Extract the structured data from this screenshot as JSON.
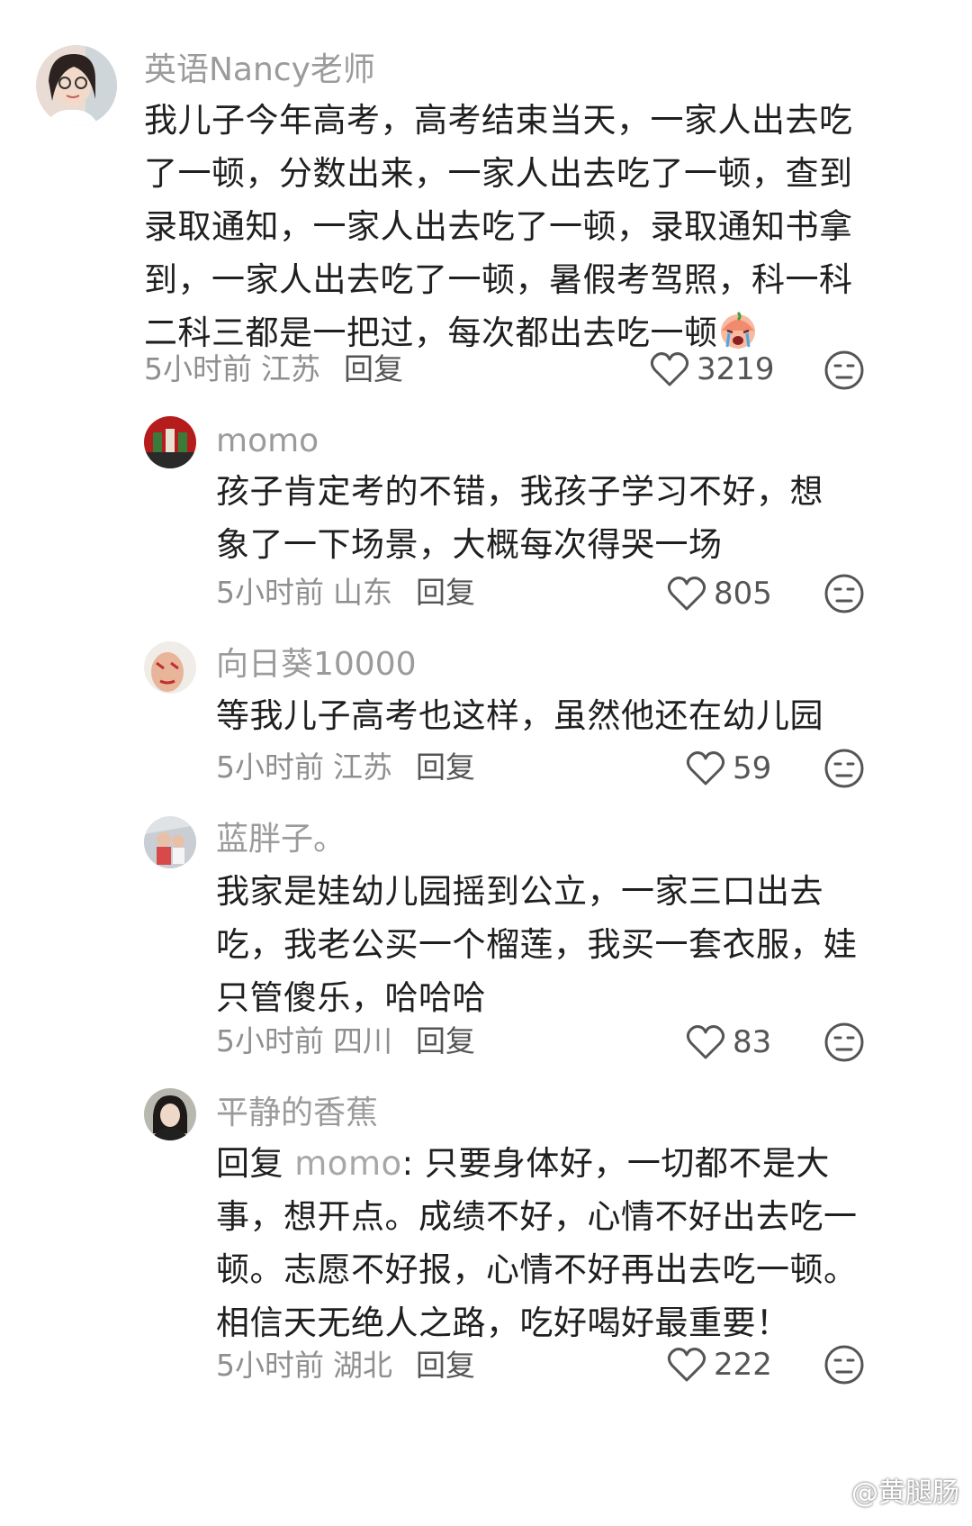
{
  "comments": [
    {
      "user": "英语Nancy老师",
      "text": "我儿子今年高考，高考结束当天，一家人出去吃了一顿，分数出来，一家人出去吃了一顿，查到录取通知，一家人出去吃了一顿，录取通知书拿到，一家人出去吃了一顿，暑假考驾照，科一科二科三都是一把过，每次都出去吃一顿",
      "emoji": "crying-face-emoji",
      "time": "5小时前",
      "location": "江苏",
      "reply_label": "回复",
      "likes": "3219"
    },
    {
      "user": "momo",
      "text": "孩子肯定考的不错，我孩子学习不好，想象了一下场景，大概每次得哭一场",
      "time": "5小时前",
      "location": "山东",
      "reply_label": "回复",
      "likes": "805"
    },
    {
      "user": "向日葵10000",
      "text": "等我儿子高考也这样，虽然他还在幼儿园",
      "time": "5小时前",
      "location": "江苏",
      "reply_label": "回复",
      "likes": "59"
    },
    {
      "user": "蓝胖子。",
      "text": "我家是娃幼儿园摇到公立，一家三口出去吃，我老公买一个榴莲，我买一套衣服，娃只管傻乐，哈哈哈",
      "time": "5小时前",
      "location": "四川",
      "reply_label": "回复",
      "likes": "83"
    },
    {
      "user": "平静的香蕉",
      "reply_prefix": "回复 ",
      "reply_target": "momo",
      "text": ": 只要身体好，一切都不是大事，想开点。成绩不好，心情不好出去吃一顿。志愿不好报，心情不好再出去吃一顿。相信天无绝人之路，吃好喝好最重要！",
      "time": "5小时前",
      "location": "湖北",
      "reply_label": "回复",
      "likes": "222"
    }
  ],
  "watermark": "@黄腿肠",
  "colors": {
    "username": "#9b9b9b",
    "text": "#1f1f1f",
    "meta": "#8f8f8f"
  }
}
